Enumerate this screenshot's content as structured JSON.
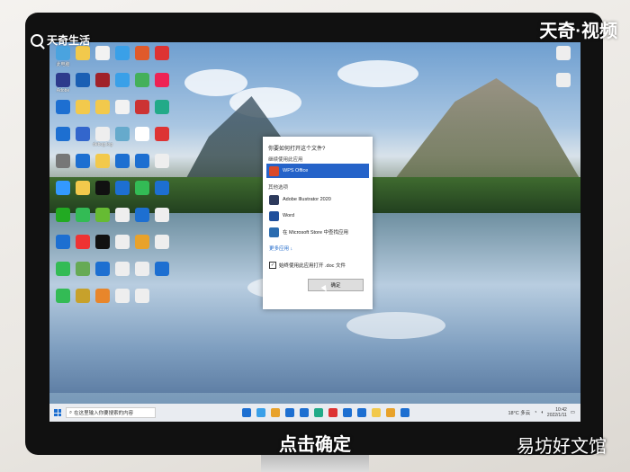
{
  "watermarks": {
    "top_left": "天奇生活",
    "top_right": "天奇·视频",
    "bottom_right": "易坊好文馆"
  },
  "caption": "点击确定",
  "dialog": {
    "title": "你要如何打开这个文件?",
    "keep_label": "继续使用此应用",
    "selected_app": "WPS Office",
    "other_label": "其他选项",
    "apps": [
      "Adobe Illustrator 2020",
      "Word",
      "在 Microsoft Store 中查找应用"
    ],
    "more_apps": "更多应用 ↓",
    "always_use": "始终使用此应用打开 .doc 文件",
    "always_checked": true,
    "ok_label": "确定"
  },
  "desktop_icons": [
    {
      "label": "此电脑",
      "color": "#4aa3df"
    },
    {
      "label": "",
      "color": "#f2c94c"
    },
    {
      "label": "",
      "color": "#f2f2f2"
    },
    {
      "label": "",
      "color": "#3aa0e8"
    },
    {
      "label": "",
      "color": "#e05a2b"
    },
    {
      "label": "",
      "color": "#d33"
    },
    {
      "label": "Adobe",
      "color": "#2d3a8c"
    },
    {
      "label": "",
      "color": "#1a5fb4"
    },
    {
      "label": "",
      "color": "#a0222a"
    },
    {
      "label": "",
      "color": "#3aa0e8"
    },
    {
      "label": "",
      "color": "#44b05a"
    },
    {
      "label": "",
      "color": "#e25"
    },
    {
      "label": "",
      "color": "#1d6fd1"
    },
    {
      "label": "",
      "color": "#f2c94c"
    },
    {
      "label": "",
      "color": "#f2c94c"
    },
    {
      "label": "",
      "color": "#f2f2f2"
    },
    {
      "label": "",
      "color": "#c33"
    },
    {
      "label": "",
      "color": "#2a8"
    },
    {
      "label": "",
      "color": "#1d6fd1"
    },
    {
      "label": "",
      "color": "#36c"
    },
    {
      "label": "debug.log",
      "color": "#eee"
    },
    {
      "label": "",
      "color": "#6ac"
    },
    {
      "label": "",
      "color": "#fff"
    },
    {
      "label": "",
      "color": "#d33"
    },
    {
      "label": "",
      "color": "#777"
    },
    {
      "label": "",
      "color": "#1d6fd1"
    },
    {
      "label": "",
      "color": "#f2c94c"
    },
    {
      "label": "",
      "color": "#1d6fd1"
    },
    {
      "label": "",
      "color": "#1d6fd1"
    },
    {
      "label": "",
      "color": "#eee"
    },
    {
      "label": "",
      "color": "#39f"
    },
    {
      "label": "",
      "color": "#f2c94c"
    },
    {
      "label": "",
      "color": "#111"
    },
    {
      "label": "",
      "color": "#1d6fd1"
    },
    {
      "label": "",
      "color": "#3b5"
    },
    {
      "label": "",
      "color": "#1d6fd1"
    },
    {
      "label": "",
      "color": "#2a2"
    },
    {
      "label": "",
      "color": "#3b5"
    },
    {
      "label": "",
      "color": "#6b3"
    },
    {
      "label": "",
      "color": "#eee"
    },
    {
      "label": "",
      "color": "#1d6fd1"
    },
    {
      "label": "",
      "color": "#eee"
    },
    {
      "label": "",
      "color": "#1d6fd1"
    },
    {
      "label": "",
      "color": "#e33"
    },
    {
      "label": "",
      "color": "#111"
    },
    {
      "label": "",
      "color": "#eee"
    },
    {
      "label": "",
      "color": "#e8a22b"
    },
    {
      "label": "",
      "color": "#eee"
    },
    {
      "label": "",
      "color": "#3b5"
    },
    {
      "label": "",
      "color": "#6a5"
    },
    {
      "label": "",
      "color": "#1d6fd1"
    },
    {
      "label": "",
      "color": "#eee"
    },
    {
      "label": "",
      "color": "#eee"
    },
    {
      "label": "",
      "color": "#1d6fd1"
    },
    {
      "label": "",
      "color": "#3b5"
    },
    {
      "label": "",
      "color": "#c7a12b"
    },
    {
      "label": "",
      "color": "#e8862b"
    },
    {
      "label": "",
      "color": "#eee"
    },
    {
      "label": "",
      "color": "#eee"
    }
  ],
  "right_icons": [
    {
      "color": "#eee"
    },
    {
      "color": "#eee"
    }
  ],
  "taskbar": {
    "search_placeholder": "在这里输入你要搜索的内容",
    "weather": "18°C 多云",
    "time": "10:42",
    "date": "2022/1/11",
    "apps": [
      "#1d6fd1",
      "#3aa0e8",
      "#e8a22b",
      "#1d6fd1",
      "#1d6fd1",
      "#2a8",
      "#d33",
      "#1d6fd1",
      "#1d6fd1",
      "#f2c94c",
      "#e8a22b",
      "#1d6fd1"
    ]
  }
}
